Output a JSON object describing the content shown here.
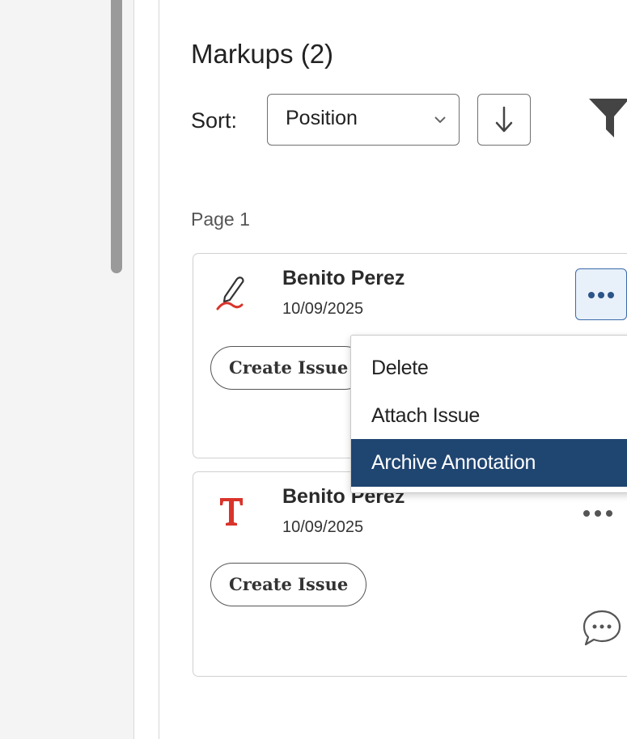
{
  "panel": {
    "title": "Markups (2)",
    "sort_label": "Sort:",
    "sort_value": "Position",
    "page_label": "Page 1"
  },
  "markups": [
    {
      "author": "Benito Perez",
      "date": "10/09/2025",
      "icon": "pen-icon",
      "button": "Create Issue",
      "accent": "#d9342b"
    },
    {
      "author": "Benito Perez",
      "date": "10/09/2025",
      "icon": "text-icon",
      "button": "Create Issue",
      "accent": "#d9342b"
    }
  ],
  "context_menu": {
    "items": [
      "Delete",
      "Attach Issue",
      "Archive Annotation"
    ],
    "active_index": 2,
    "active_color": "#1f4571"
  },
  "icons": {
    "sort_direction": "arrow-down-icon",
    "filter": "filter-icon",
    "more": "more-icon",
    "comment": "comment-icon"
  }
}
